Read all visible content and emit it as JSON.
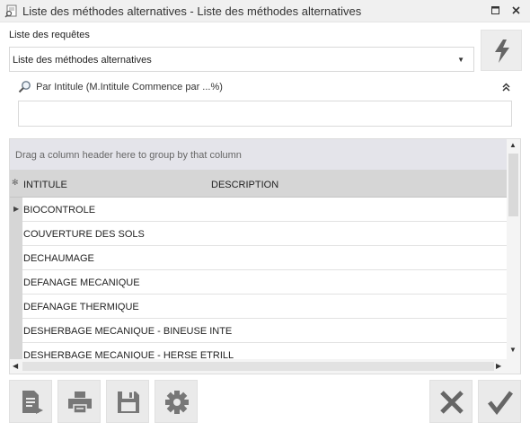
{
  "window": {
    "title": "Liste des méthodes alternatives - Liste des méthodes alternatives",
    "app_icon": "form-search-icon",
    "maximize_icon": "maximize-icon",
    "close_icon": "close-icon"
  },
  "queries": {
    "label": "Liste des requêtes",
    "selected": "Liste des méthodes alternatives",
    "execute_icon": "lightning-icon"
  },
  "search": {
    "label": "Par Intitule (M.Intitule Commence par ...%)",
    "value": "",
    "icon": "search-icon",
    "collapse_icon": "double-chevron-up-icon"
  },
  "grid": {
    "group_panel_text": "Drag a column header here to group by that column",
    "columns": [
      "INTITULE",
      "DESCRIPTION"
    ],
    "rows": [
      {
        "intitule": "BIOCONTROLE",
        "description": "",
        "current": true
      },
      {
        "intitule": "COUVERTURE DES SOLS",
        "description": ""
      },
      {
        "intitule": "DECHAUMAGE",
        "description": ""
      },
      {
        "intitule": "DEFANAGE MECANIQUE",
        "description": ""
      },
      {
        "intitule": "DEFANAGE THERMIQUE",
        "description": ""
      },
      {
        "intitule": "DESHERBAGE MECANIQUE - BINEUSE INTE",
        "description": ""
      },
      {
        "intitule": "DESHERBAGE MECANIQUE - HERSE ETRILL",
        "description": ""
      }
    ]
  },
  "toolbar": {
    "left": [
      "export-icon",
      "print-icon",
      "save-icon",
      "settings-icon"
    ],
    "cancel_icon": "cancel-x-icon",
    "validate_icon": "checkmark-icon"
  },
  "colors": {
    "titlebar_bg": "#f0f0f0",
    "header_bg": "#d6d6d6",
    "group_panel_bg": "#e4e4ea",
    "button_bg": "#eaeaea",
    "icon_gray": "#666666"
  }
}
